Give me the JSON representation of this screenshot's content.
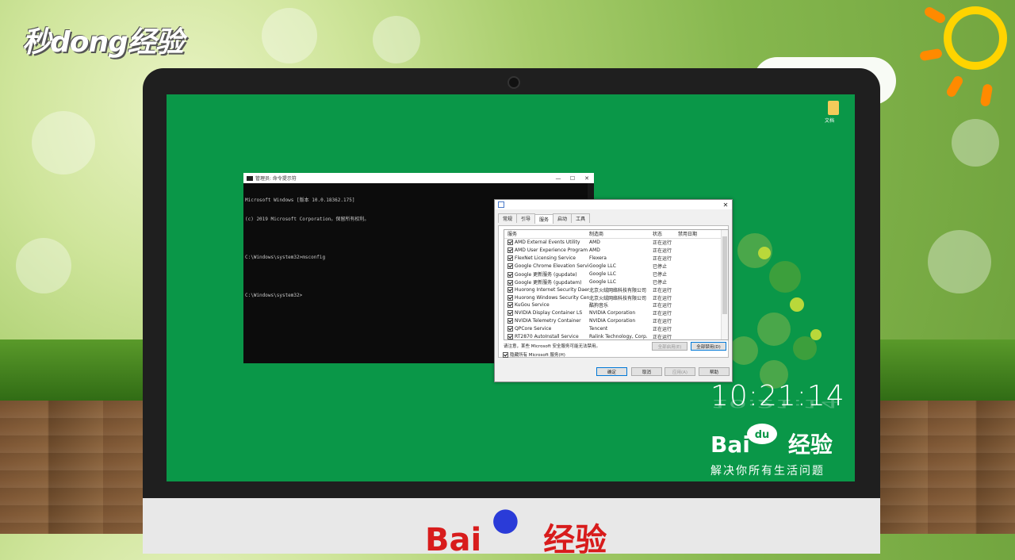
{
  "watermark": {
    "text": "秒dong经验"
  },
  "desktop": {
    "folder_label": "文档"
  },
  "cmd": {
    "title": "管理员: 命令提示符",
    "lines": [
      "Microsoft Windows [版本 10.0.18362.175]",
      "(c) 2019 Microsoft Corporation。保留所有权利。",
      "",
      "C:\\Windows\\system32>msconfig",
      "",
      "C:\\Windows\\system32>"
    ],
    "controls": [
      "—",
      "☐",
      "✕"
    ]
  },
  "msconfig": {
    "close": "✕",
    "tabs": [
      "常规",
      "引导",
      "服务",
      "启动",
      "工具"
    ],
    "active_tab": "服务",
    "columns": [
      "服务",
      "制造商",
      "状态",
      "禁用日期"
    ],
    "rows": [
      {
        "service": "AMD External Events Utility",
        "maker": "AMD",
        "status": "正在运行"
      },
      {
        "service": "AMD User Experience Program L...",
        "maker": "AMD",
        "status": "正在运行"
      },
      {
        "service": "FlexNet Licensing Service",
        "maker": "Flexera",
        "status": "正在运行"
      },
      {
        "service": "Google Chrome Elevation Service",
        "maker": "Google LLC",
        "status": "已停止"
      },
      {
        "service": "Google 更新服务 (gupdate)",
        "maker": "Google LLC",
        "status": "已停止"
      },
      {
        "service": "Google 更新服务 (gupdatem)",
        "maker": "Google LLC",
        "status": "已停止"
      },
      {
        "service": "Huorong Internet Security Daem...",
        "maker": "北京火绒网络科技有限公司",
        "status": "正在运行"
      },
      {
        "service": "Huorong Windows Security Center",
        "maker": "北京火绒网络科技有限公司",
        "status": "正在运行"
      },
      {
        "service": "KuGou Service",
        "maker": "酷狗音乐",
        "status": "正在运行"
      },
      {
        "service": "NVIDIA Display Container LS",
        "maker": "NVIDIA Corporation",
        "status": "正在运行"
      },
      {
        "service": "NVIDIA Telemetry Container",
        "maker": "NVIDIA Corporation",
        "status": "正在运行"
      },
      {
        "service": "QPCore Service",
        "maker": "Tencent",
        "status": "正在运行"
      },
      {
        "service": "RT2870 AutoInstall Service",
        "maker": "Ralink Technology, Corp.",
        "status": "正在运行"
      }
    ],
    "note": "请注意，某些 Microsoft 安全服务可能无法禁用。",
    "enable_all": "全部启用(E)",
    "disable_all": "全部禁用(D)",
    "hide_ms": "隐藏所有 Microsoft 服务(H)",
    "ok": "确定",
    "cancel": "取消",
    "apply": "应用(A)",
    "help": "帮助"
  },
  "clock": {
    "time": "10:21:14"
  },
  "baidu": {
    "logo_text": "Bai",
    "paw_text": "du",
    "logo_suffix": "经验",
    "tagline": "解决你所有生活问题"
  },
  "chin_logo": {
    "text": "Bai",
    "suffix": "经验"
  },
  "colors": {
    "desktop_green": "#0a9748",
    "cmd_bg": "#0c0c0c",
    "accent_blue": "#0078d7"
  }
}
